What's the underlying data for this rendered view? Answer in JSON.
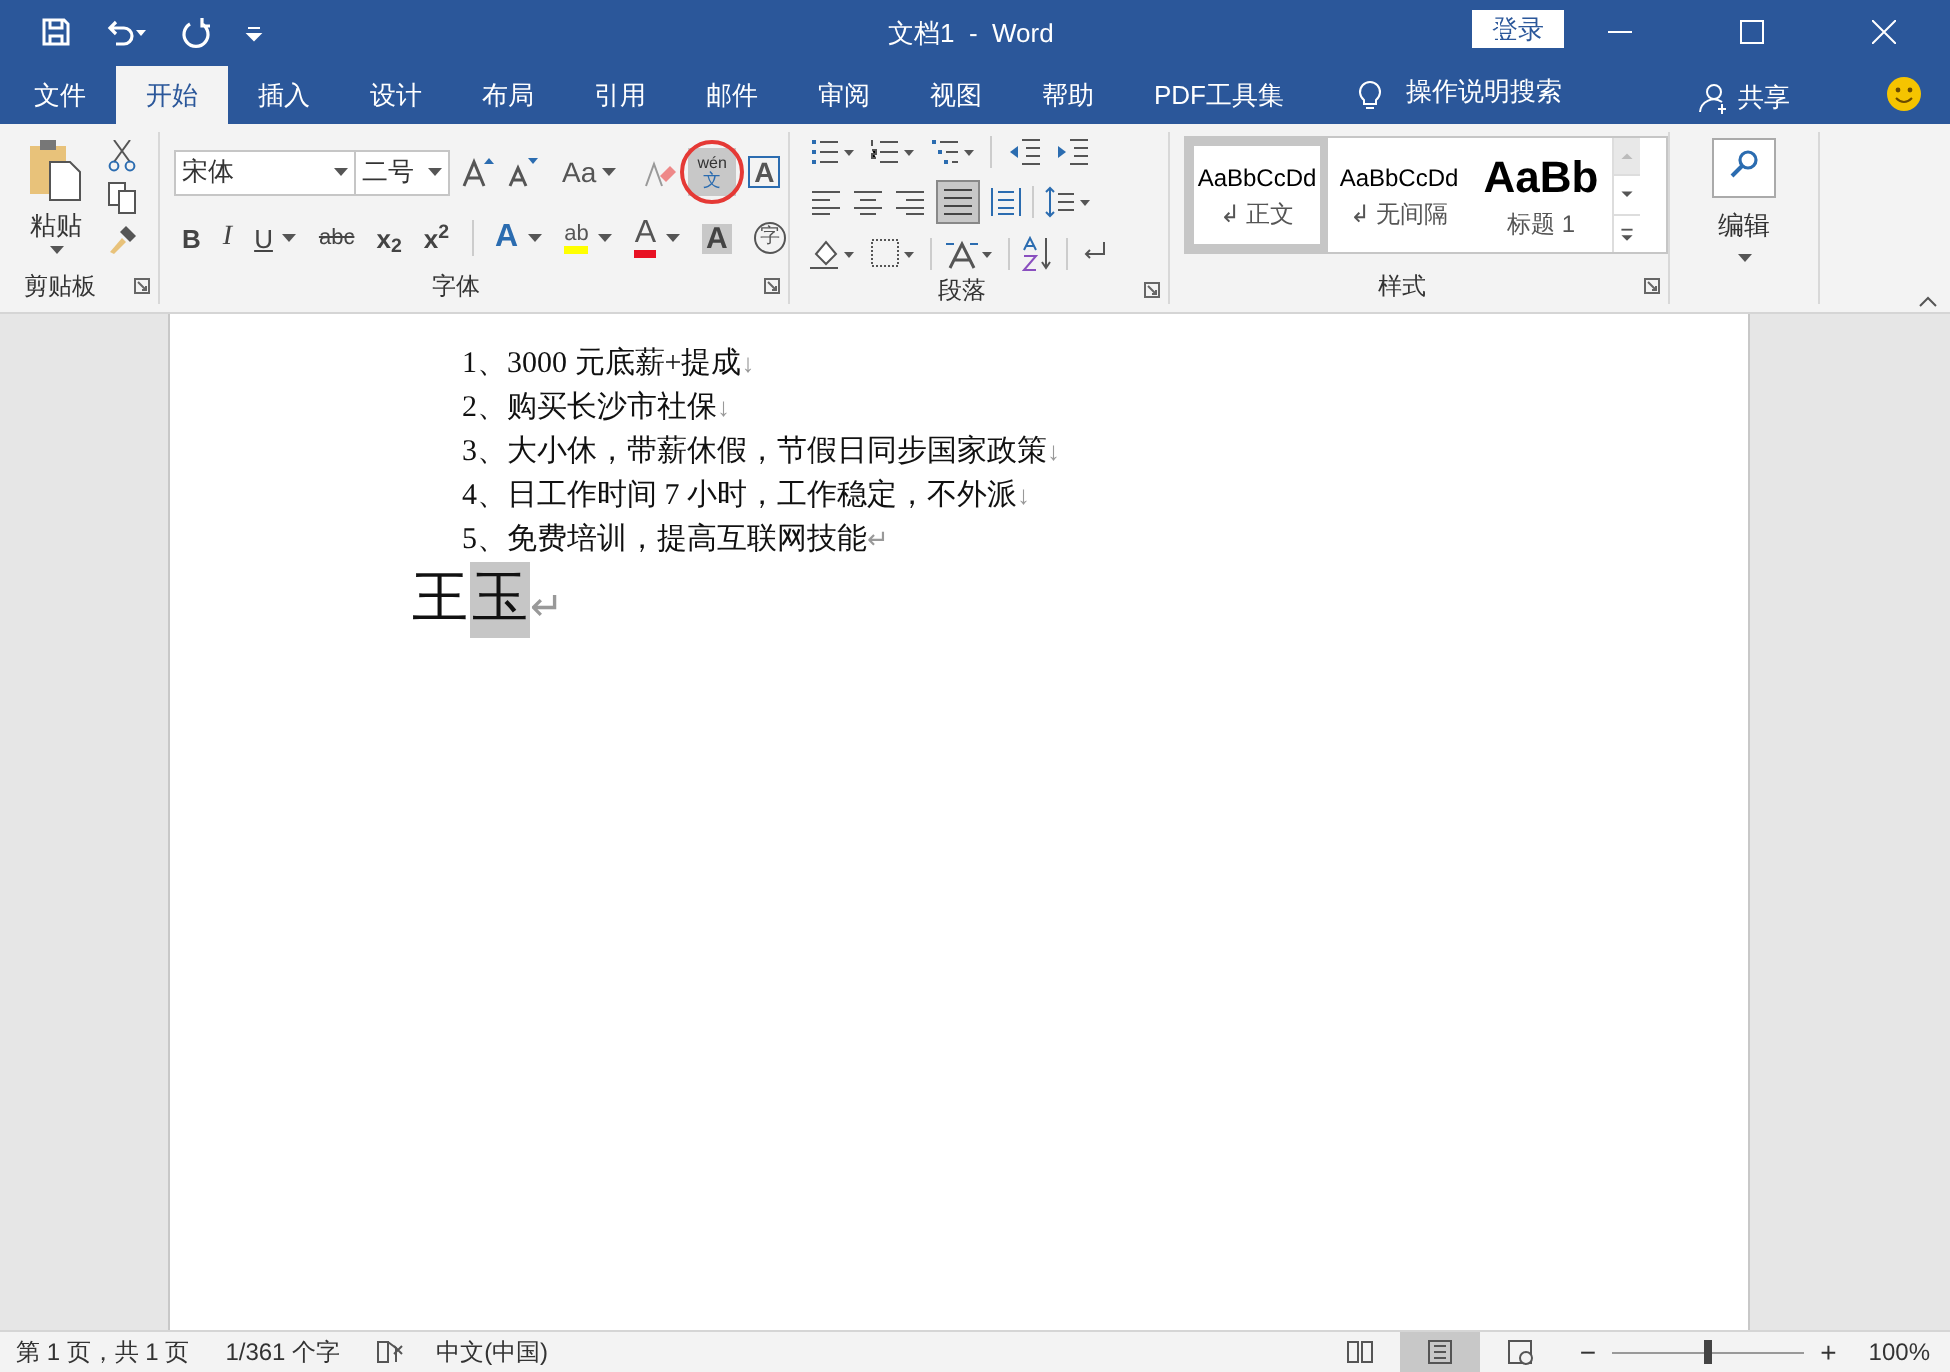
{
  "window": {
    "title": "文档1  -  Word",
    "login": "登录"
  },
  "tabs": [
    {
      "label": "文件",
      "selected": false
    },
    {
      "label": "开始",
      "selected": true
    },
    {
      "label": "插入",
      "selected": false
    },
    {
      "label": "设计",
      "selected": false
    },
    {
      "label": "布局",
      "selected": false
    },
    {
      "label": "引用",
      "selected": false
    },
    {
      "label": "邮件",
      "selected": false
    },
    {
      "label": "审阅",
      "selected": false
    },
    {
      "label": "视图",
      "selected": false
    },
    {
      "label": "帮助",
      "selected": false
    },
    {
      "label": "PDF工具集",
      "selected": false
    }
  ],
  "tell_me": "操作说明搜索",
  "share": "共享",
  "ribbon": {
    "clipboard": {
      "label": "剪贴板",
      "paste": "粘贴"
    },
    "font": {
      "label": "字体",
      "font_name": "宋体",
      "font_size": "二号",
      "case_button": "Aa",
      "phonetic": {
        "top": "wén",
        "bottom": "文",
        "circled": true
      },
      "border_char": "A",
      "format_buttons": [
        {
          "kind": "bold",
          "text": "B"
        },
        {
          "kind": "italic",
          "text": "I"
        },
        {
          "kind": "underline",
          "text": "U"
        },
        {
          "kind": "strike",
          "text": "abc"
        },
        {
          "kind": "sub",
          "text": "x$_{2}$"
        },
        {
          "kind": "sup",
          "text": "x$^{2}$"
        }
      ],
      "effect_buttons": [
        {
          "kind": "effect",
          "text": "A"
        },
        {
          "kind": "highlight",
          "text": "ab"
        },
        {
          "kind": "color",
          "text": "A"
        },
        {
          "kind": "shade",
          "text": "A"
        },
        {
          "kind": "enclose",
          "text": "字"
        }
      ]
    },
    "paragraph": {
      "label": "段落"
    },
    "styles": {
      "label": "样式",
      "items": [
        {
          "preview": "AaBbCcDd",
          "name": "↲ 正文",
          "selected": true,
          "kind": "normal"
        },
        {
          "preview": "AaBbCcDd",
          "name": "↲ 无间隔",
          "selected": false,
          "kind": "normal"
        },
        {
          "preview": "AaBb",
          "name": "标题 1",
          "selected": false,
          "kind": "heading"
        }
      ]
    },
    "editing": {
      "label": "编辑"
    }
  },
  "document": {
    "lines": [
      {
        "text": "1、3000 元底薪+提成",
        "mark": "↓"
      },
      {
        "text": "2、购买长沙市社保",
        "mark": "↓"
      },
      {
        "text": "3、大小休，带薪休假，节假日同步国家政策",
        "mark": "↓"
      },
      {
        "text": "4、日工作时间 7 小时，工作稳定，不外派",
        "mark": "↓"
      },
      {
        "text": "5、免费培训，提高互联网技能",
        "mark": "↵"
      }
    ],
    "name_chars": [
      {
        "text": "王",
        "selected": false
      },
      {
        "text": "玉",
        "selected": true
      }
    ],
    "name_mark": "↵"
  },
  "status_bar": {
    "page": "第 1 页，共 1 页",
    "words": "1/361 个字",
    "language": "中文(中国)",
    "views": [
      {
        "kind": "read",
        "selected": false
      },
      {
        "kind": "print",
        "selected": true
      },
      {
        "kind": "web",
        "selected": false
      }
    ],
    "zoom_minus": "−",
    "zoom_plus": "+",
    "zoom": {
      "level": 0.5
    },
    "zoom_text": "100%"
  }
}
